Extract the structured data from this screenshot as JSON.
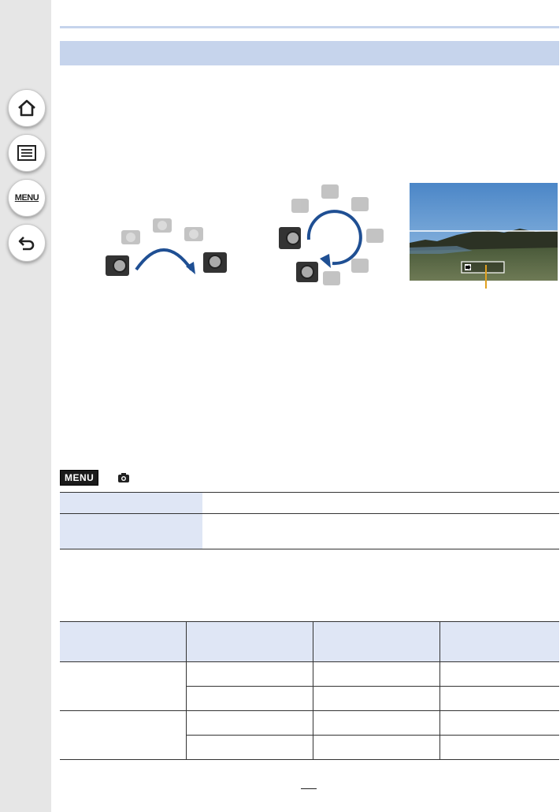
{
  "sidebar": {
    "home_icon": "home-icon",
    "toc_icon": "list-icon",
    "menu_label": "MENU",
    "back_icon": "back-icon"
  },
  "menu_path": {
    "badge": "MENU",
    "icon": "camera-icon"
  },
  "colors": {
    "sidebar_bg": "#e6e6e6",
    "section_bar": "#c6d4ec",
    "table_header": "#dfe6f5",
    "arrow_blue": "#1f4f93",
    "indicator_orange": "#e0a020"
  }
}
